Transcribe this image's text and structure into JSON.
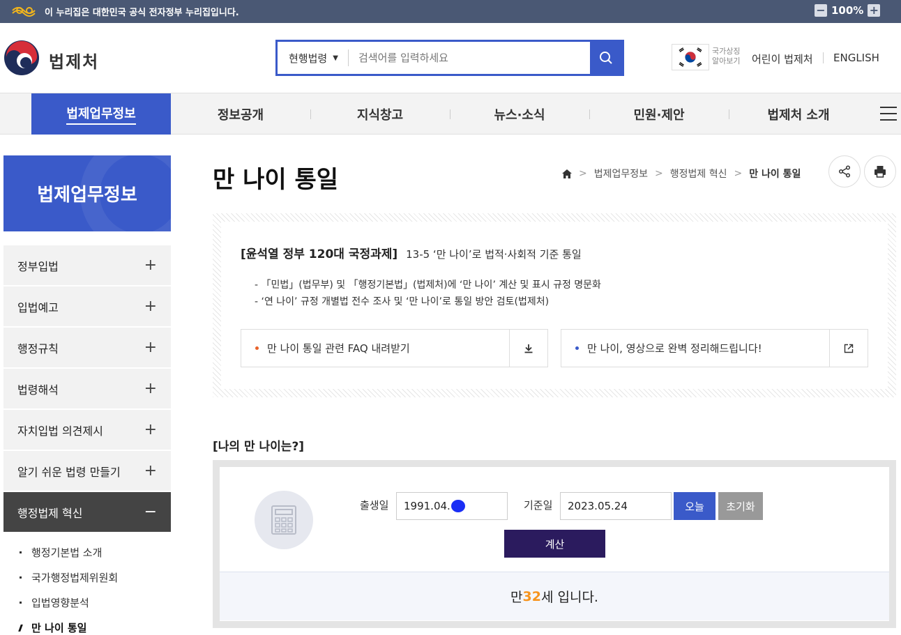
{
  "gov_banner": {
    "text": "이 누리집은 대한민국 공식 전자정부 누리집입니다.",
    "zoom_minus": "−",
    "zoom_value": "100%",
    "zoom_plus": "+"
  },
  "header": {
    "logo_text": "법제처",
    "search": {
      "select_value": "현행법령",
      "placeholder": "검색어를 입력하세요"
    },
    "flag_caption_1": "국가상징",
    "flag_caption_2": "알아보기",
    "kids_link": "어린이 법제처",
    "english_link": "ENGLISH"
  },
  "gnb": {
    "items": [
      "법제업무정보",
      "정보공개",
      "지식창고",
      "뉴스·소식",
      "민원·제안",
      "법제처 소개"
    ]
  },
  "sidebar": {
    "title": "법제업무정보",
    "items": [
      {
        "label": "정부입법",
        "toggle": "+"
      },
      {
        "label": "입법예고",
        "toggle": "+"
      },
      {
        "label": "행정규칙",
        "toggle": "+"
      },
      {
        "label": "법령해석",
        "toggle": "+"
      },
      {
        "label": "자치입법 의견제시",
        "toggle": "+"
      },
      {
        "label": "알기 쉬운 법령 만들기",
        "toggle": "+"
      },
      {
        "label": "행정법제 혁신",
        "toggle": "−"
      }
    ],
    "sub_items": [
      "행정기본법 소개",
      "국가행정법제위원회",
      "입법영향분석",
      "만 나이 통일"
    ]
  },
  "page": {
    "title": "만 나이 통일",
    "breadcrumb": [
      "법제업무정보",
      "행정법제 혁신",
      "만 나이 통일"
    ]
  },
  "info": {
    "heading": "[윤석열 정부 120대 국정과제]",
    "heading_sub": "13-5 ‘만 나이’로 법적·사회적 기준 통일",
    "line1": "- 「민법」(법무부) 및 「행정기본법」(법제처)에 ‘만 나이’ 계산 및 표시 규정 명문화",
    "line2": "- ‘연 나이’ 규정 개별법 전수 조사 및 ‘만 나이’로 통일 방안 검토(법제처)",
    "link1": "만 나이 통일 관련 FAQ 내려받기",
    "link2": "만 나이, 영상으로 완벽 정리해드립니다!",
    "dot1_color": "#e8622a",
    "dot2_color": "#3a5ac9"
  },
  "calculator": {
    "title": "[나의 만 나이는?]",
    "birth_label": "출생일",
    "birth_value": "1991.04.",
    "base_label": "기준일",
    "base_value": "2023.05.24",
    "today_button": "오늘",
    "reset_button": "초기화",
    "calc_button": "계산",
    "result_prefix": "만 ",
    "result_age": "32",
    "result_suffix": "세 입니다."
  },
  "colors": {
    "primary": "#3a5ac9",
    "dark": "#2b1b5e",
    "accent": "#f7941d"
  }
}
